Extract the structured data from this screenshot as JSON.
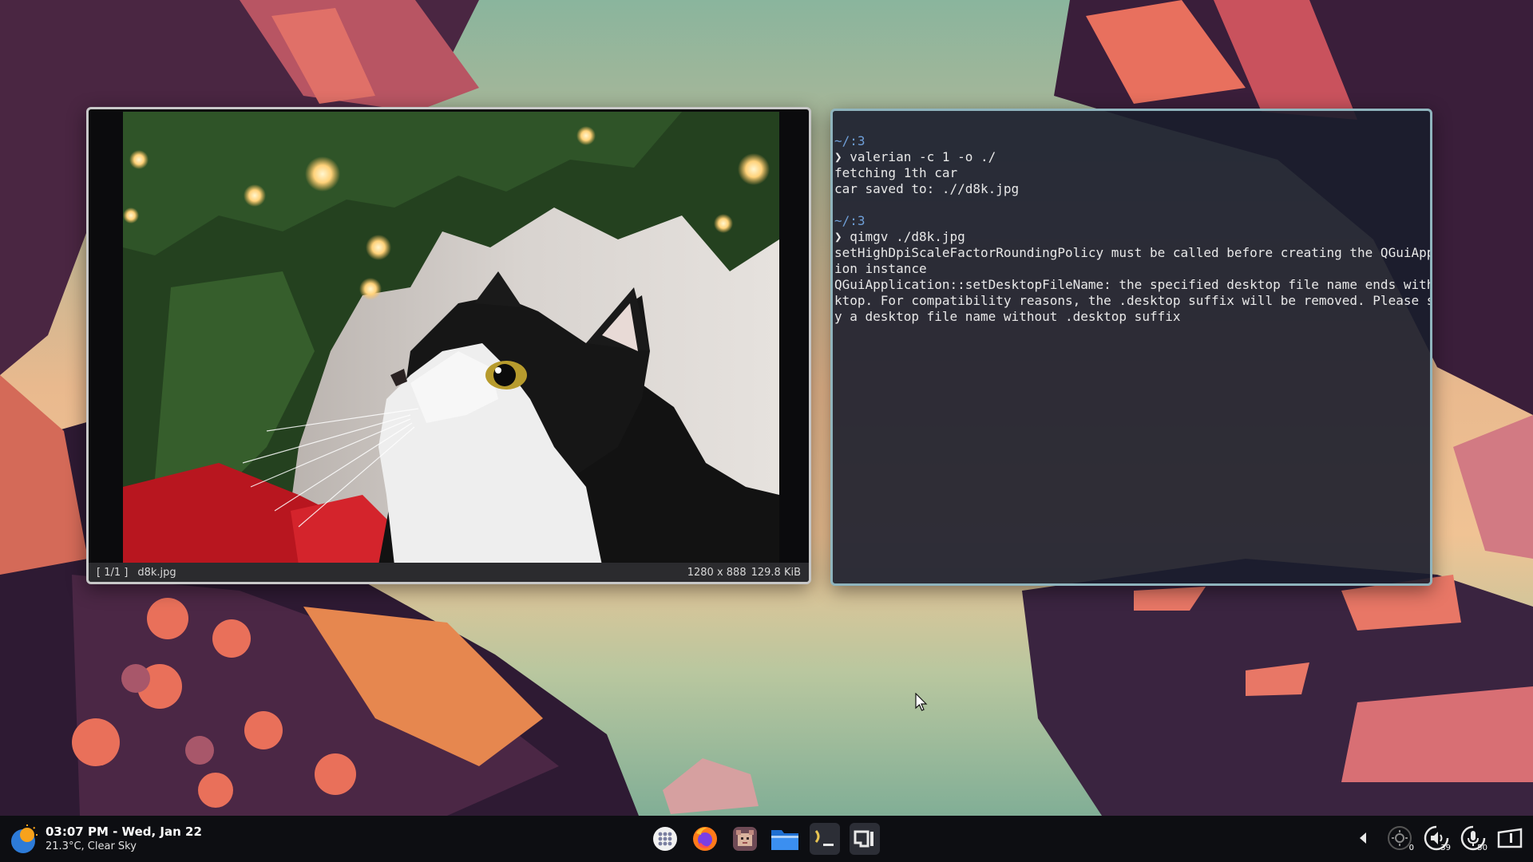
{
  "image_viewer": {
    "index": "[ 1/1 ]",
    "filename": "d8k.jpg",
    "dimensions": "1280 x 888",
    "filesize": "129.8 KiB"
  },
  "terminal": {
    "lines": [
      {
        "kind": "dir",
        "text": "~/:3"
      },
      {
        "kind": "cmd",
        "text": "valerian -c 1 -o ./"
      },
      {
        "kind": "out",
        "text": "fetching 1th car"
      },
      {
        "kind": "out",
        "text": "car saved to: .//d8k.jpg"
      },
      {
        "kind": "blank",
        "text": ""
      },
      {
        "kind": "dir",
        "text": "~/:3"
      },
      {
        "kind": "cmd",
        "text": "qimgv ./d8k.jpg"
      },
      {
        "kind": "out",
        "text": "setHighDpiScaleFactorRoundingPolicy must be called before creating the QGuiApplicat"
      },
      {
        "kind": "out",
        "text": "ion instance"
      },
      {
        "kind": "out",
        "text": "QGuiApplication::setDesktopFileName: the specified desktop file name ends with .des"
      },
      {
        "kind": "out",
        "text": "ktop. For compatibility reasons, the .desktop suffix will be removed. Please specif"
      },
      {
        "kind": "out",
        "text": "y a desktop file name without .desktop suffix"
      }
    ]
  },
  "taskbar": {
    "clock": "03:07 PM - Wed, Jan 22",
    "weather": "21.3°C, Clear Sky",
    "dock": [
      {
        "name": "app-launcher-icon"
      },
      {
        "name": "firefox-icon"
      },
      {
        "name": "pixel-avatar-app-icon"
      },
      {
        "name": "file-manager-icon"
      },
      {
        "name": "terminal-icon"
      },
      {
        "name": "image-viewer-icon"
      }
    ],
    "tray": {
      "brightness": "0",
      "volume": "39",
      "microphone": "50"
    }
  },
  "colors": {
    "terminal_border": "#8fb4bd",
    "prompt_dir": "#6f9fd8",
    "taskbar_bg": "#0d0e12"
  }
}
